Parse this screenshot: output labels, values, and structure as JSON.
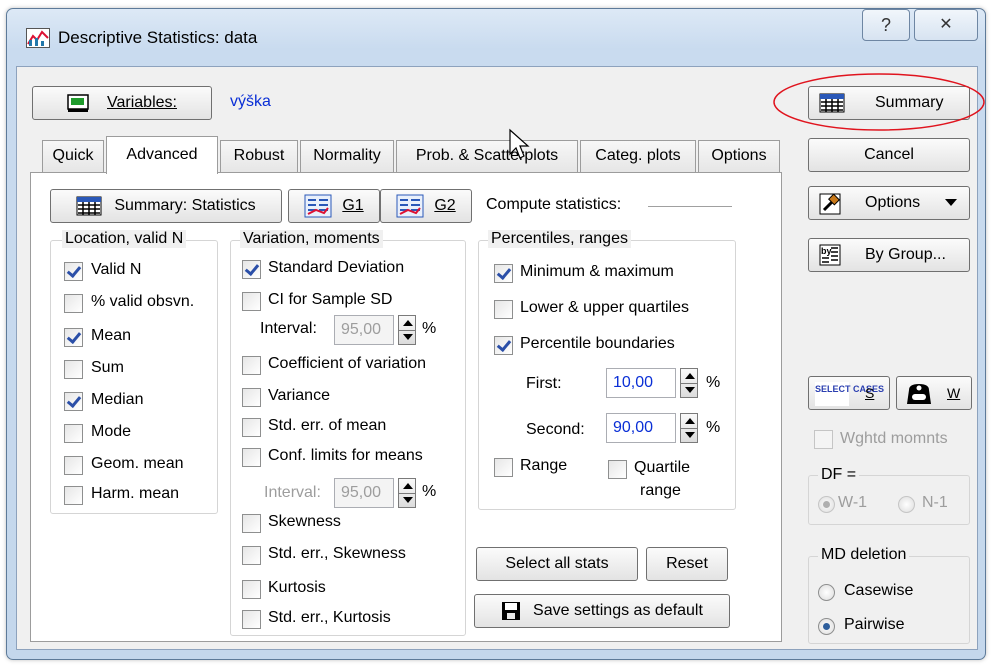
{
  "window": {
    "title": "Descriptive Statistics: data",
    "help": "?",
    "close": "✕"
  },
  "variables": {
    "button": "Variables:",
    "value": "výška"
  },
  "tabs": [
    "Quick",
    "Advanced",
    "Robust",
    "Normality",
    "Prob. & Scatterplots",
    "Categ. plots",
    "Options"
  ],
  "right": {
    "summary": "Summary",
    "cancel": "Cancel",
    "options": "Options",
    "by_group": "By Group...",
    "select_cases_icon": "SELECT CASES",
    "select_cases_key": "S",
    "weight_key": "W",
    "wghtd": "Wghtd momnts",
    "df": {
      "title": "DF =",
      "opt1": "W-1",
      "opt2": "N-1",
      "selected": "W-1"
    },
    "md": {
      "title": "MD deletion",
      "opt1": "Casewise",
      "opt2": "Pairwise",
      "selected": "Pairwise"
    }
  },
  "toolbar": {
    "summary_stats": "Summary: Statistics",
    "g1": "G1",
    "g2": "G2",
    "compute": "Compute statistics:"
  },
  "location": {
    "title": "Location, valid N",
    "items": [
      {
        "label": "Valid N",
        "checked": true
      },
      {
        "label": "% valid obsvn.",
        "checked": false
      },
      {
        "label": "Mean",
        "checked": true
      },
      {
        "label": "Sum",
        "checked": false
      },
      {
        "label": "Median",
        "checked": true
      },
      {
        "label": "Mode",
        "checked": false
      },
      {
        "label": "Geom. mean",
        "checked": false
      },
      {
        "label": "Harm. mean",
        "checked": false
      }
    ]
  },
  "variation": {
    "title": "Variation, moments",
    "std_dev": "Standard Deviation",
    "ci_sd": "CI for Sample SD",
    "interval_label": "Interval:",
    "interval_value": "95,00",
    "percent": "%",
    "coef_var": "Coefficient of variation",
    "variance": "Variance",
    "se_mean": "Std. err. of mean",
    "conf_limits": "Conf. limits for means",
    "interval2_label": "Interval:",
    "interval2_value": "95,00",
    "skewness": "Skewness",
    "se_skewness": "Std. err., Skewness",
    "kurtosis": "Kurtosis",
    "se_kurtosis": "Std. err., Kurtosis"
  },
  "percentiles": {
    "title": "Percentiles, ranges",
    "minmax": "Minimum & maximum",
    "quartiles": "Lower & upper quartiles",
    "boundaries": "Percentile boundaries",
    "first_label": "First:",
    "first_value": "10,00",
    "second_label": "Second:",
    "second_value": "90,00",
    "percent": "%",
    "range": "Range",
    "quartile_range_1": "Quartile",
    "quartile_range_2": "range"
  },
  "actions": {
    "select_all": "Select all stats",
    "reset": "Reset",
    "save_default": "Save settings as default"
  },
  "colors": {
    "link": "#0a2fd6",
    "highlight_oval": "#e0141e"
  }
}
